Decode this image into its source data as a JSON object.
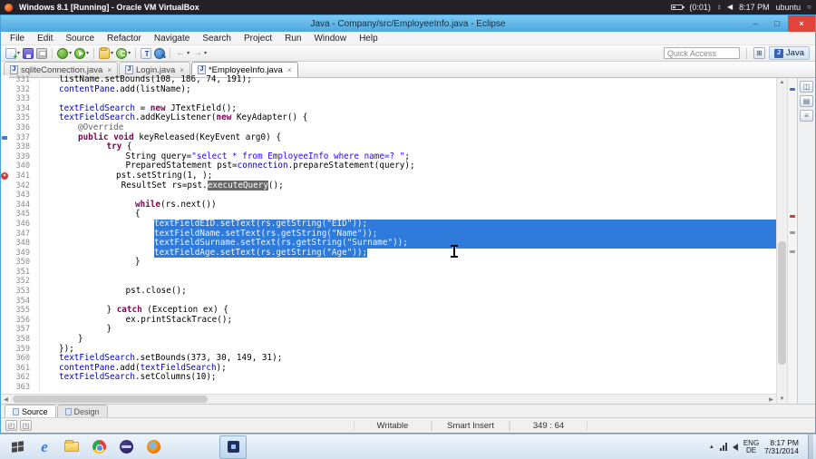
{
  "host_bar": {
    "title": "Windows 8.1 [Running] - Oracle VM VirtualBox",
    "battery_time": "(0:01)",
    "clock": "8:17 PM",
    "user": "ubuntu"
  },
  "window": {
    "title": "Java - Company/src/EmployeeInfo.java - Eclipse",
    "minimize": "–",
    "maximize": "□",
    "close": "×"
  },
  "menu": [
    "File",
    "Edit",
    "Source",
    "Refactor",
    "Navigate",
    "Search",
    "Project",
    "Run",
    "Window",
    "Help"
  ],
  "toolbar": {
    "quick_access": "Quick Access",
    "perspective": "Java",
    "icons": [
      {
        "id": "new",
        "caret": true
      },
      {
        "id": "save"
      },
      {
        "id": "print"
      },
      {
        "id": "sep"
      },
      {
        "id": "debug",
        "caret": true
      },
      {
        "id": "run",
        "caret": true
      },
      {
        "id": "sep"
      },
      {
        "id": "new-project",
        "caret": true
      },
      {
        "id": "new-class",
        "caret": true
      },
      {
        "id": "sep"
      },
      {
        "id": "open-type"
      },
      {
        "id": "search"
      },
      {
        "id": "sep"
      },
      {
        "id": "back",
        "caret": true
      },
      {
        "id": "forward",
        "caret": true
      }
    ]
  },
  "editor_tabs": [
    {
      "label": "sqliteConnection.java",
      "active": false
    },
    {
      "label": "Login.java",
      "active": false
    },
    {
      "label": "*EmployeeInfo.java",
      "active": true
    }
  ],
  "code": {
    "lines": [
      {
        "n": 331,
        "i": 1,
        "seg": [
          [
            "p",
            "listName.setBounds(108, 186, 74, 191);"
          ]
        ]
      },
      {
        "n": 332,
        "i": 1,
        "seg": [
          [
            "f",
            "contentPane"
          ],
          [
            "p",
            ".add(listName);"
          ]
        ]
      },
      {
        "n": 333,
        "i": 0,
        "seg": []
      },
      {
        "n": 334,
        "i": 1,
        "seg": [
          [
            "f",
            "textFieldSearch"
          ],
          [
            "p",
            " = "
          ],
          [
            "k",
            "new"
          ],
          [
            "p",
            " JTextField();"
          ]
        ]
      },
      {
        "n": 335,
        "i": 1,
        "seg": [
          [
            "f",
            "textFieldSearch"
          ],
          [
            "p",
            ".addKeyListener("
          ],
          [
            "k",
            "new"
          ],
          [
            "p",
            " KeyAdapter() {"
          ]
        ]
      },
      {
        "n": 336,
        "i": 2,
        "seg": [
          [
            "a",
            "@Override"
          ]
        ]
      },
      {
        "n": 337,
        "i": 2,
        "seg": [
          [
            "k",
            "public"
          ],
          [
            "p",
            " "
          ],
          [
            "k",
            "void"
          ],
          [
            "p",
            " keyReleased(KeyEvent arg0) {"
          ]
        ],
        "mark": "info"
      },
      {
        "n": 338,
        "i": 3.5,
        "seg": [
          [
            "k",
            "try"
          ],
          [
            "p",
            " {"
          ]
        ]
      },
      {
        "n": 339,
        "i": 4.5,
        "seg": [
          [
            "p",
            "String query="
          ],
          [
            "s",
            "\"select * from EmployeeInfo where name=? \""
          ],
          [
            "p",
            ";"
          ]
        ]
      },
      {
        "n": 340,
        "i": 4.5,
        "seg": [
          [
            "p",
            "PreparedStatement pst="
          ],
          [
            "f",
            "connection"
          ],
          [
            "p",
            ".prepareStatement(query);"
          ]
        ]
      },
      {
        "n": 341,
        "i": 4,
        "seg": [
          [
            "p",
            "pst.setString(1, );"
          ]
        ],
        "mark": "error"
      },
      {
        "n": 342,
        "i": 4,
        "seg": [
          [
            "p",
            " ResultSet rs=pst."
          ],
          [
            "o",
            "executeQuery"
          ],
          [
            "p",
            "();"
          ]
        ]
      },
      {
        "n": 343,
        "i": 0,
        "seg": []
      },
      {
        "n": 344,
        "i": 5,
        "seg": [
          [
            "k",
            "while"
          ],
          [
            "p",
            "(rs.next())"
          ]
        ]
      },
      {
        "n": 345,
        "i": 5,
        "seg": [
          [
            "p",
            "{"
          ]
        ]
      },
      {
        "n": 346,
        "i": 6,
        "seg": [
          [
            "f",
            "textFieldEID"
          ],
          [
            "p",
            ".setText(rs.getString("
          ],
          [
            "s",
            "\"EID\""
          ],
          [
            "p",
            "));"
          ]
        ],
        "sel": "full"
      },
      {
        "n": 347,
        "i": 6,
        "seg": [
          [
            "f",
            "textFieldName"
          ],
          [
            "p",
            ".setText(rs.getString("
          ],
          [
            "s",
            "\"Name\""
          ],
          [
            "p",
            "));"
          ]
        ],
        "sel": "full"
      },
      {
        "n": 348,
        "i": 6,
        "seg": [
          [
            "f",
            "textFieldSurname"
          ],
          [
            "p",
            ".setText(rs.getString("
          ],
          [
            "s",
            "\"Surname\""
          ],
          [
            "p",
            "));"
          ]
        ],
        "sel": "full"
      },
      {
        "n": 349,
        "i": 6,
        "seg": [
          [
            "f",
            "textFieldAge"
          ],
          [
            "p",
            ".setText(rs.getString("
          ],
          [
            "s",
            "\"Age\""
          ],
          [
            "p",
            "));"
          ]
        ],
        "sel": "text"
      },
      {
        "n": 350,
        "i": 5,
        "seg": [
          [
            "p",
            "}"
          ]
        ]
      },
      {
        "n": 351,
        "i": 0,
        "seg": []
      },
      {
        "n": 352,
        "i": 0,
        "seg": []
      },
      {
        "n": 353,
        "i": 4.5,
        "seg": [
          [
            "p",
            "pst.close();"
          ]
        ]
      },
      {
        "n": 354,
        "i": 0,
        "seg": []
      },
      {
        "n": 355,
        "i": 3.5,
        "seg": [
          [
            "p",
            "} "
          ],
          [
            "k",
            "catch"
          ],
          [
            "p",
            " (Exception ex) {"
          ]
        ]
      },
      {
        "n": 356,
        "i": 4.5,
        "seg": [
          [
            "p",
            "ex.printStackTrace();"
          ]
        ]
      },
      {
        "n": 357,
        "i": 3.5,
        "seg": [
          [
            "p",
            "}"
          ]
        ]
      },
      {
        "n": 358,
        "i": 2,
        "seg": [
          [
            "p",
            "}"
          ]
        ]
      },
      {
        "n": 359,
        "i": 1,
        "seg": [
          [
            "p",
            "});"
          ]
        ]
      },
      {
        "n": 360,
        "i": 1,
        "seg": [
          [
            "f",
            "textFieldSearch"
          ],
          [
            "p",
            ".setBounds(373, 30, 149, 31);"
          ]
        ]
      },
      {
        "n": 361,
        "i": 1,
        "seg": [
          [
            "f",
            "contentPane"
          ],
          [
            "p",
            ".add("
          ],
          [
            "f",
            "textFieldSearch"
          ],
          [
            "p",
            ");"
          ]
        ]
      },
      {
        "n": 362,
        "i": 1,
        "seg": [
          [
            "f",
            "textFieldSearch"
          ],
          [
            "p",
            ".setColumns(10);"
          ]
        ]
      },
      {
        "n": 363,
        "i": 0,
        "seg": []
      }
    ]
  },
  "overview_markers": [
    {
      "pos": 0.03,
      "color": "#3b6fc4"
    },
    {
      "pos": 0.42,
      "color": "#cf3a2c"
    },
    {
      "pos": 0.47,
      "color": "#9a9a9a"
    },
    {
      "pos": 0.53,
      "color": "#9a9a9a"
    }
  ],
  "right_strip": [
    "restore-views",
    "task-list-view",
    "outline-view"
  ],
  "bottom_tabs": [
    {
      "label": "Source",
      "active": true
    },
    {
      "label": "Design",
      "active": false
    }
  ],
  "status": {
    "writable": "Writable",
    "mode": "Smart Insert",
    "caret": "349 : 64"
  },
  "taskbar": {
    "apps": [
      {
        "id": "start"
      },
      {
        "id": "internet-explorer"
      },
      {
        "id": "file-explorer"
      },
      {
        "id": "chrome"
      },
      {
        "id": "eclipse"
      },
      {
        "id": "firefox"
      },
      {
        "id": "running-app",
        "active": true
      }
    ],
    "tray": {
      "lang_primary": "ENG",
      "lang_secondary": "DE",
      "time": "8:17 PM",
      "date": "7/31/2014"
    }
  },
  "colors": {
    "selection": "#2e7bdc",
    "titlebar": "#4aa8dd",
    "error": "#d23b30",
    "keyword": "#7f0055",
    "string": "#2a00ff",
    "field": "#0000c0"
  }
}
